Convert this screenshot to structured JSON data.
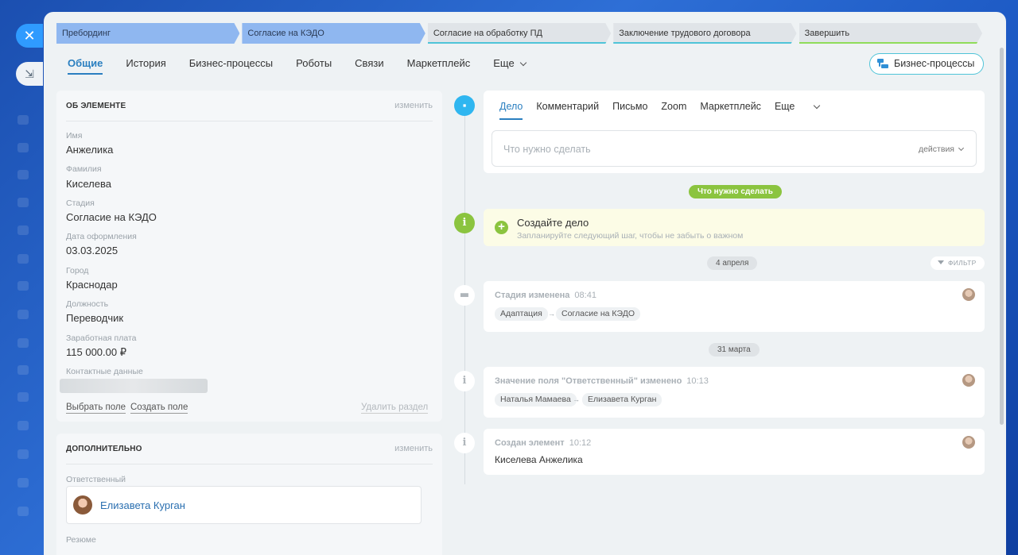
{
  "stages": [
    {
      "label": "Пребординг",
      "state": "done"
    },
    {
      "label": "Согласие на КЭДО",
      "state": "done"
    },
    {
      "label": "Согласие на обработку ПД",
      "state": "todo"
    },
    {
      "label": "Заключение трудового договора",
      "state": "todo"
    },
    {
      "label": "Завершить",
      "state": "final"
    }
  ],
  "tabs": [
    {
      "label": "Общие",
      "active": true
    },
    {
      "label": "История"
    },
    {
      "label": "Бизнес-процессы"
    },
    {
      "label": "Роботы"
    },
    {
      "label": "Связи"
    },
    {
      "label": "Маркетплейс"
    },
    {
      "label": "Еще"
    }
  ],
  "bp_button": "Бизнес-процессы",
  "about": {
    "title": "ОБ ЭЛЕМЕНТЕ",
    "edit": "изменить",
    "fields": [
      {
        "label": "Имя",
        "value": "Анжелика"
      },
      {
        "label": "Фамилия",
        "value": "Киселева"
      },
      {
        "label": "Стадия",
        "value": "Согласие на КЭДО"
      },
      {
        "label": "Дата оформления",
        "value": "03.03.2025"
      },
      {
        "label": "Город",
        "value": "Краснодар"
      },
      {
        "label": "Должность",
        "value": "Переводчик"
      },
      {
        "label": "Заработная плата",
        "value": "115 000.00 ₽"
      },
      {
        "label": "Контактные данные",
        "value": ""
      }
    ],
    "select_field": "Выбрать поле",
    "create_field": "Создать поле",
    "delete_section": "Удалить раздел"
  },
  "extra": {
    "title": "ДОПОЛНИТЕЛЬНО",
    "edit": "изменить",
    "responsible_label": "Ответственный",
    "responsible_name": "Елизавета Курган",
    "resume_label": "Резюме"
  },
  "activity": {
    "tabs": [
      "Дело",
      "Комментарий",
      "Письмо",
      "Zoom",
      "Маркетплейс",
      "Еще"
    ],
    "placeholder": "Что нужно сделать",
    "actions": "действия"
  },
  "todo_pill": "Что нужно сделать",
  "create_task": {
    "title": "Создайте дело",
    "subtitle": "Запланируйте следующий шаг, чтобы не забыть о важном"
  },
  "date1": "4 апреля",
  "filter": "ФИЛЬТР",
  "event1": {
    "title": "Стадия изменена",
    "time": "08:41",
    "from": "Адаптация",
    "to": "Согласие на КЭДО"
  },
  "date2": "31 марта",
  "event2": {
    "title": "Значение поля \"Ответственный\" изменено",
    "time": "10:13",
    "from": "Наталья Мамаева",
    "to": "Елизавета Курган"
  },
  "event3": {
    "title": "Создан элемент",
    "time": "10:12",
    "body": "Киселева Анжелика"
  },
  "arrow": "→"
}
